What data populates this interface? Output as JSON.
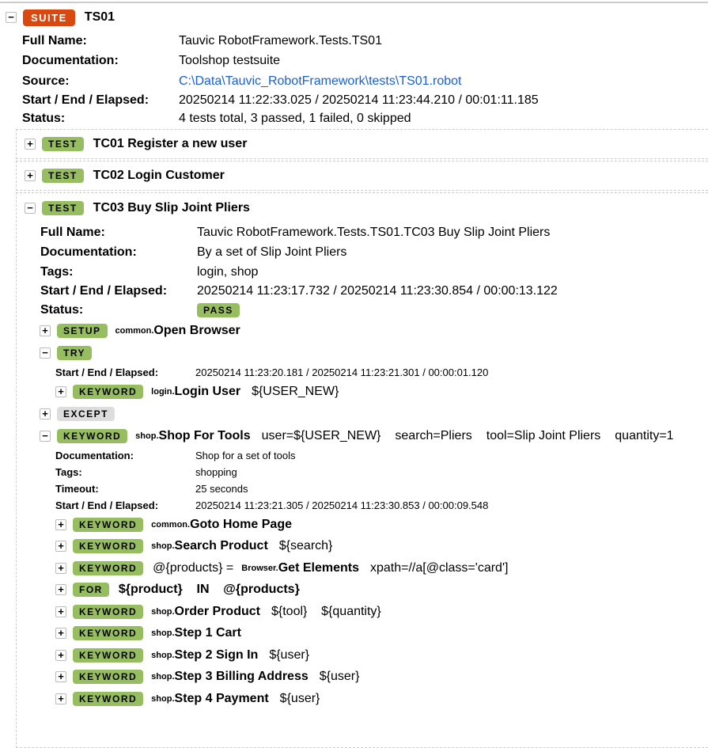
{
  "suite": {
    "badge": "SUITE",
    "name": "TS01",
    "info": [
      {
        "label": "Full Name:",
        "value": "Tauvic RobotFramework.Tests.TS01"
      },
      {
        "label": "Documentation:",
        "value": "Toolshop testsuite"
      },
      {
        "label": "Source:",
        "value": "C:\\Data\\Tauvic_RobotFramework\\tests\\TS01.robot"
      },
      {
        "label": "Start / End / Elapsed:",
        "value": "20250214 11:22:33.025 / 20250214 11:23:44.210 / 00:01:11.185"
      },
      {
        "label": "Status:",
        "value": "4 tests total, 3 passed, 1 failed, 0 skipped"
      }
    ]
  },
  "tests": [
    {
      "badge": "TEST",
      "name": "TC01 Register a new user"
    },
    {
      "badge": "TEST",
      "name": "TC02 Login Customer"
    },
    {
      "badge": "TEST",
      "name": "TC03 Buy Slip Joint Pliers"
    }
  ],
  "tc03": {
    "info": [
      {
        "label": "Full Name:",
        "value": "Tauvic RobotFramework.Tests.TS01.TC03 Buy Slip Joint Pliers"
      },
      {
        "label": "Documentation:",
        "value": "By a set of Slip Joint Pliers"
      },
      {
        "label": "Tags:",
        "value": "login, shop"
      },
      {
        "label": "Start / End / Elapsed:",
        "value": "20250214 11:23:17.732 / 20250214 11:23:30.854 / 00:00:13.122"
      },
      {
        "label": "Status:",
        "value": "PASS"
      }
    ],
    "setup": {
      "badge": "SETUP",
      "lib": "common.",
      "name": "Open Browser"
    },
    "try": {
      "badge": "TRY",
      "info": {
        "label": "Start / End / Elapsed:",
        "value": "20250214 11:23:20.181 / 20250214 11:23:21.301 / 00:00:01.120"
      },
      "kw": {
        "badge": "KEYWORD",
        "lib": "login.",
        "name": "Login User",
        "args": "${USER_NEW}"
      }
    },
    "except": {
      "badge": "EXCEPT"
    },
    "shop": {
      "badge": "KEYWORD",
      "lib": "shop.",
      "name": "Shop For Tools",
      "args": [
        "user=${USER_NEW}",
        "search=Pliers",
        "tool=Slip Joint Pliers",
        "quantity=1"
      ],
      "info": [
        {
          "label": "Documentation:",
          "value": "Shop for a set of tools"
        },
        {
          "label": "Tags:",
          "value": "shopping"
        },
        {
          "label": "Timeout:",
          "value": "25 seconds"
        },
        {
          "label": "Start / End / Elapsed:",
          "value": "20250214 11:23:21.305 / 20250214 11:23:30.853 / 00:00:09.548"
        }
      ],
      "children": [
        {
          "badge": "KEYWORD",
          "pre": "",
          "lib": "common.",
          "name": "Goto Home Page",
          "args": ""
        },
        {
          "badge": "KEYWORD",
          "pre": "",
          "lib": "shop.",
          "name": "Search Product",
          "args": "${search}"
        },
        {
          "badge": "KEYWORD",
          "pre": "@{products} =",
          "lib": "Browser.",
          "name": "Get Elements",
          "args": "xpath=//a[@class='card']"
        },
        {
          "badge": "FOR",
          "pre": "",
          "lib": "",
          "name": "${product}    IN    @{products}",
          "args": ""
        },
        {
          "badge": "KEYWORD",
          "pre": "",
          "lib": "shop.",
          "name": "Order Product",
          "args": "${tool}    ${quantity}"
        },
        {
          "badge": "KEYWORD",
          "pre": "",
          "lib": "shop.",
          "name": "Step 1 Cart",
          "args": ""
        },
        {
          "badge": "KEYWORD",
          "pre": "",
          "lib": "shop.",
          "name": "Step 2 Sign In",
          "args": "${user}"
        },
        {
          "badge": "KEYWORD",
          "pre": "",
          "lib": "shop.",
          "name": "Step 3 Billing Address",
          "args": "${user}"
        },
        {
          "badge": "KEYWORD",
          "pre": "",
          "lib": "shop.",
          "name": "Step 4 Payment",
          "args": "${user}"
        }
      ]
    }
  },
  "colors": {
    "suite": "#d9480f",
    "pass": "#97bd61",
    "except": "#dddddd",
    "link": "#1a5fd4"
  }
}
